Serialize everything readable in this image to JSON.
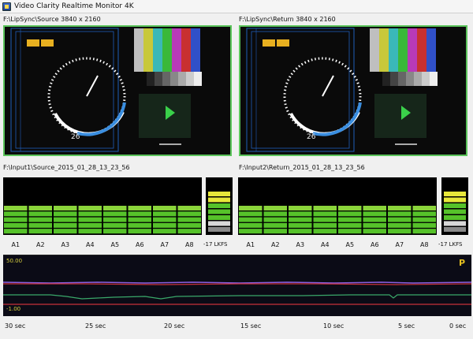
{
  "window": {
    "title": "Video Clarity Realtime Monitor 4K"
  },
  "video": {
    "left": {
      "label": "F:\\LipSync\\Source 3840 x 2160",
      "frame_number": "26"
    },
    "right": {
      "label": "F:\\LipSync\\Return 3840 x 2160",
      "frame_number": "26"
    }
  },
  "audio": {
    "left_label": "F:\\Input1\\Source_2015_01_28_13_23_56",
    "right_label": "F:\\Input2\\Return_2015_01_28_13_23_56",
    "channels": [
      "A1",
      "A2",
      "A3",
      "A4",
      "A5",
      "A6",
      "A7",
      "A8"
    ],
    "lkfs_label": "-17 LKFS",
    "colors": {
      "meter_green": "#56c22a",
      "meter_yellow": "#e8e83a",
      "meter_white": "#d8d8d8",
      "meter_gray": "#8a8a8a"
    }
  },
  "graph": {
    "y_top": "50.00",
    "y_bottom": "-1.00",
    "marker": "P",
    "time_labels": [
      "30 sec",
      "25 sec",
      "20 sec",
      "15 sec",
      "10 sec",
      "5 sec",
      "0 sec"
    ],
    "colors": {
      "purple_line": "#8a5fe0",
      "red_line": "#c8303a",
      "green_line": "#3aa86a"
    }
  },
  "icons": {
    "app": "app-icon",
    "tone_triangle": "play-triangle-icon"
  }
}
